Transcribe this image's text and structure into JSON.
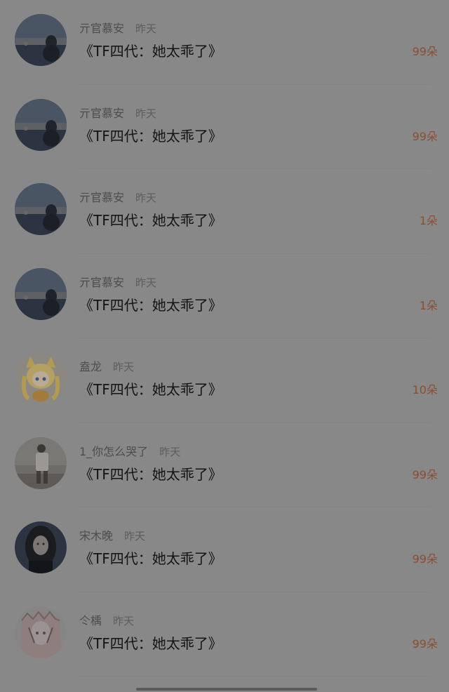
{
  "items": [
    {
      "name": "亓官慕安",
      "time": "昨天",
      "title": "《TF四代：她太乖了》",
      "count": "99朵",
      "avatar": "sunset-sea-avatar"
    },
    {
      "name": "亓官慕安",
      "time": "昨天",
      "title": "《TF四代：她太乖了》",
      "count": "99朵",
      "avatar": "sunset-sea-avatar"
    },
    {
      "name": "亓官慕安",
      "time": "昨天",
      "title": "《TF四代：她太乖了》",
      "count": "1朵",
      "avatar": "sunset-sea-avatar"
    },
    {
      "name": "亓官慕安",
      "time": "昨天",
      "title": "《TF四代：她太乖了》",
      "count": "1朵",
      "avatar": "sunset-sea-avatar"
    },
    {
      "name": "盍龙",
      "time": "昨天",
      "title": "《TF四代：她太乖了》",
      "count": "10朵",
      "avatar": "anime-cat-girl-avatar"
    },
    {
      "name": "1_你怎么哭了",
      "time": "昨天",
      "title": "《TF四代：她太乖了》",
      "count": "99朵",
      "avatar": "street-photo-avatar"
    },
    {
      "name": "宋木晚",
      "time": "昨天",
      "title": "《TF四代：她太乖了》",
      "count": "99朵",
      "avatar": "dark-portrait-avatar"
    },
    {
      "name": "仒楀",
      "time": "昨天",
      "title": "《TF四代：她太乖了》",
      "count": "99朵",
      "avatar": "manga-girl-avatar"
    }
  ]
}
